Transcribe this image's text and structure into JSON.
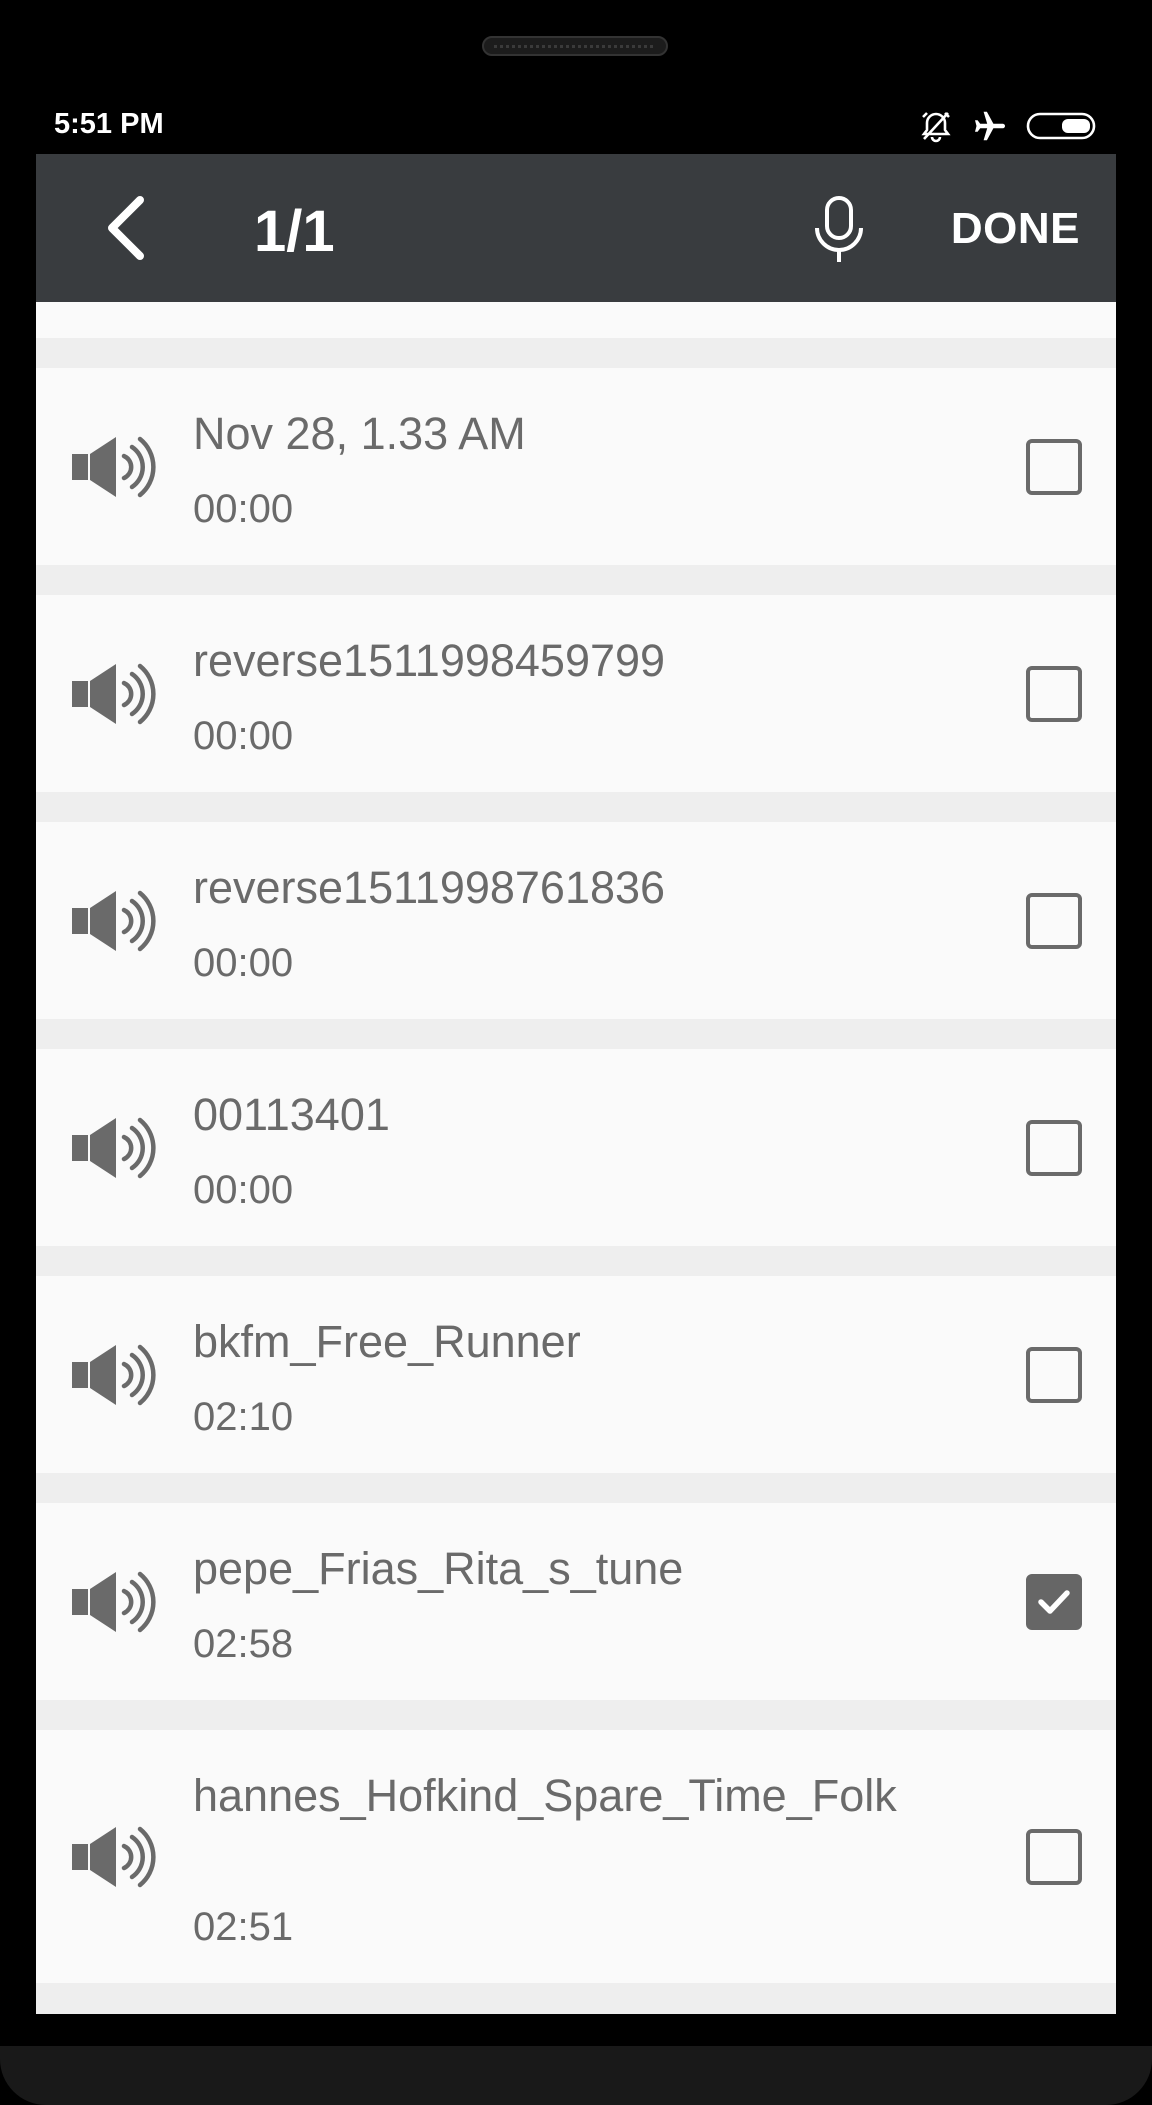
{
  "status_bar": {
    "time": "5:51 PM",
    "icons": [
      "alarm-off-icon",
      "airplane-mode-icon",
      "battery-icon"
    ]
  },
  "app_bar": {
    "title": "1/1",
    "done_label": "DONE",
    "icons": [
      "back-chevron-icon",
      "microphone-icon"
    ]
  },
  "recordings": [
    {
      "title": "Nov 28, 1.33 AM",
      "duration": "00:00",
      "checked": false
    },
    {
      "title": "reverse1511998459799",
      "duration": "00:00",
      "checked": false
    },
    {
      "title": "reverse1511998761836",
      "duration": "00:00",
      "checked": false
    },
    {
      "title": "00113401",
      "duration": "00:00",
      "checked": false
    },
    {
      "title": "bkfm_Free_Runner",
      "duration": "02:10",
      "checked": false
    },
    {
      "title": "pepe_Frias_Rita_s_tune",
      "duration": "02:58",
      "checked": true
    },
    {
      "title": "hannes_Hofkind_Spare_Time_Folk",
      "duration": "02:51",
      "checked": false
    }
  ],
  "colors": {
    "app_bar": "#393c3f",
    "item_bg": "#fafafa",
    "separator": "#eeeeee",
    "text": "#6a6a6a"
  }
}
